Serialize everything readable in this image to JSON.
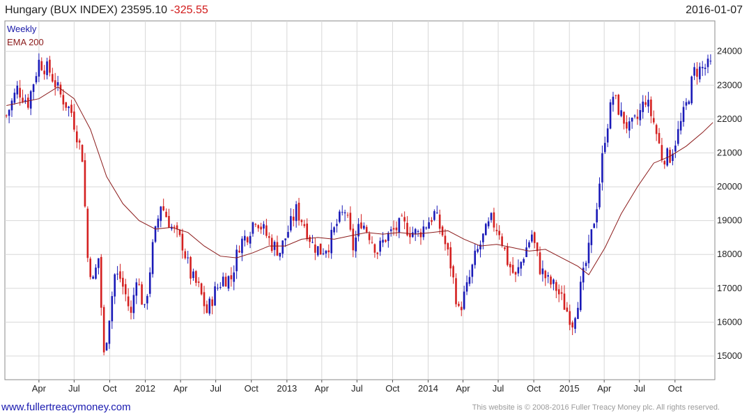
{
  "header": {
    "name": "Hungary (BUX INDEX)",
    "last": "23595.10",
    "change": "-325.55",
    "date": "2016-01-07"
  },
  "legend": {
    "series1": "Weekly",
    "series2": "EMA 200"
  },
  "footer": {
    "link": "www.fullertreacymoney.com",
    "copyright": "This website is © 2008-2016 Fuller Treacy Money plc. All rights reserved."
  },
  "colors": {
    "up": "#1a1ab8",
    "down": "#d42020",
    "ema": "#8b1a1a",
    "grid": "#d8d8d8",
    "change": "#d11a1a"
  },
  "chart_data": {
    "type": "line",
    "title": "Hungary (BUX INDEX) 23595.10 -325.55",
    "ylim": [
      14300,
      24900
    ],
    "yticks": [
      15000,
      16000,
      17000,
      18000,
      19000,
      20000,
      21000,
      22000,
      23000,
      24000
    ],
    "ytick_labels": [
      "15000",
      "16000",
      "17000",
      "18000",
      "19000",
      "20000",
      "21000",
      "22000",
      "23000",
      "24000"
    ],
    "xticks": [
      {
        "date": "2011-04-01",
        "label": "Apr"
      },
      {
        "date": "2011-07-01",
        "label": "Jul"
      },
      {
        "date": "2011-10-01",
        "label": "Oct"
      },
      {
        "date": "2012-01-01",
        "label": "2012"
      },
      {
        "date": "2012-04-01",
        "label": "Apr"
      },
      {
        "date": "2012-07-01",
        "label": "Jul"
      },
      {
        "date": "2012-10-01",
        "label": "Oct"
      },
      {
        "date": "2013-01-01",
        "label": "2013"
      },
      {
        "date": "2013-04-01",
        "label": "Apr"
      },
      {
        "date": "2013-07-01",
        "label": "Jul"
      },
      {
        "date": "2013-10-01",
        "label": "Oct"
      },
      {
        "date": "2014-01-01",
        "label": "2014"
      },
      {
        "date": "2014-04-01",
        "label": "Apr"
      },
      {
        "date": "2014-07-01",
        "label": "Jul"
      },
      {
        "date": "2014-10-01",
        "label": "Oct"
      },
      {
        "date": "2015-01-01",
        "label": "2015"
      },
      {
        "date": "2015-04-01",
        "label": "Apr"
      },
      {
        "date": "2015-07-01",
        "label": "Jul"
      },
      {
        "date": "2015-10-01",
        "label": "Oct"
      }
    ],
    "series": [
      {
        "name": "Weekly",
        "kind": "close",
        "points": [
          [
            "2011-01-07",
            22100
          ],
          [
            "2011-02-04",
            22900
          ],
          [
            "2011-03-04",
            22500
          ],
          [
            "2011-04-01",
            23700
          ],
          [
            "2011-04-29",
            23400
          ],
          [
            "2011-05-27",
            22700
          ],
          [
            "2011-06-24",
            22200
          ],
          [
            "2011-07-22",
            20900
          ],
          [
            "2011-08-05",
            17900
          ],
          [
            "2011-08-19",
            17200
          ],
          [
            "2011-09-02",
            17900
          ],
          [
            "2011-09-16",
            15000
          ],
          [
            "2011-09-30",
            16200
          ],
          [
            "2011-10-14",
            17400
          ],
          [
            "2011-10-28",
            17300
          ],
          [
            "2011-11-11",
            16800
          ],
          [
            "2011-11-25",
            16200
          ],
          [
            "2011-12-09",
            17400
          ],
          [
            "2011-12-30",
            16300
          ],
          [
            "2012-01-20",
            18200
          ],
          [
            "2012-02-10",
            19500
          ],
          [
            "2012-03-09",
            18800
          ],
          [
            "2012-04-06",
            18300
          ],
          [
            "2012-04-27",
            17400
          ],
          [
            "2012-05-18",
            17000
          ],
          [
            "2012-06-08",
            16300
          ],
          [
            "2012-06-29",
            16900
          ],
          [
            "2012-07-20",
            17300
          ],
          [
            "2012-08-10",
            17300
          ],
          [
            "2012-08-31",
            18300
          ],
          [
            "2012-09-21",
            18600
          ],
          [
            "2012-10-12",
            19100
          ],
          [
            "2012-11-02",
            18700
          ],
          [
            "2012-11-23",
            18300
          ],
          [
            "2012-12-14",
            18100
          ],
          [
            "2013-01-04",
            18700
          ],
          [
            "2013-01-25",
            19300
          ],
          [
            "2013-02-15",
            18900
          ],
          [
            "2013-03-08",
            18300
          ],
          [
            "2013-03-29",
            18100
          ],
          [
            "2013-04-19",
            18300
          ],
          [
            "2013-05-10",
            18900
          ],
          [
            "2013-05-31",
            19300
          ],
          [
            "2013-06-21",
            18200
          ],
          [
            "2013-07-12",
            19000
          ],
          [
            "2013-08-02",
            18600
          ],
          [
            "2013-08-23",
            18100
          ],
          [
            "2013-09-13",
            18500
          ],
          [
            "2013-10-04",
            18700
          ],
          [
            "2013-10-25",
            18900
          ],
          [
            "2013-11-15",
            18700
          ],
          [
            "2013-12-06",
            18600
          ],
          [
            "2013-12-27",
            18900
          ],
          [
            "2014-01-17",
            19200
          ],
          [
            "2014-02-07",
            18600
          ],
          [
            "2014-02-28",
            17700
          ],
          [
            "2014-03-21",
            16300
          ],
          [
            "2014-04-11",
            17000
          ],
          [
            "2014-05-02",
            17900
          ],
          [
            "2014-05-23",
            18500
          ],
          [
            "2014-06-13",
            19000
          ],
          [
            "2014-07-04",
            18700
          ],
          [
            "2014-07-25",
            17800
          ],
          [
            "2014-08-15",
            17300
          ],
          [
            "2014-09-05",
            18000
          ],
          [
            "2014-09-26",
            18600
          ],
          [
            "2014-10-17",
            17600
          ],
          [
            "2014-11-07",
            17200
          ],
          [
            "2014-11-28",
            17000
          ],
          [
            "2014-12-19",
            16500
          ],
          [
            "2015-01-09",
            16000
          ],
          [
            "2015-01-30",
            17000
          ],
          [
            "2015-02-20",
            18100
          ],
          [
            "2015-03-13",
            19500
          ],
          [
            "2015-04-03",
            21500
          ],
          [
            "2015-04-24",
            22700
          ],
          [
            "2015-05-15",
            22100
          ],
          [
            "2015-06-05",
            21700
          ],
          [
            "2015-06-26",
            22000
          ],
          [
            "2015-07-17",
            22600
          ],
          [
            "2015-08-07",
            21900
          ],
          [
            "2015-08-28",
            20900
          ],
          [
            "2015-09-18",
            20900
          ],
          [
            "2015-10-09",
            21600
          ],
          [
            "2015-10-30",
            22400
          ],
          [
            "2015-11-20",
            23400
          ],
          [
            "2015-12-11",
            23500
          ],
          [
            "2016-01-07",
            23595
          ]
        ]
      },
      {
        "name": "EMA 200",
        "kind": "line",
        "points": [
          [
            "2011-01-07",
            22400
          ],
          [
            "2011-04-01",
            22600
          ],
          [
            "2011-05-20",
            22950
          ],
          [
            "2011-07-01",
            22600
          ],
          [
            "2011-08-12",
            21700
          ],
          [
            "2011-09-23",
            20300
          ],
          [
            "2011-11-04",
            19500
          ],
          [
            "2011-12-16",
            19000
          ],
          [
            "2012-01-27",
            18750
          ],
          [
            "2012-03-09",
            18800
          ],
          [
            "2012-04-20",
            18650
          ],
          [
            "2012-06-01",
            18250
          ],
          [
            "2012-07-13",
            17950
          ],
          [
            "2012-08-24",
            17900
          ],
          [
            "2012-10-05",
            18050
          ],
          [
            "2012-11-16",
            18250
          ],
          [
            "2012-12-28",
            18250
          ],
          [
            "2013-02-08",
            18450
          ],
          [
            "2013-03-22",
            18500
          ],
          [
            "2013-05-03",
            18450
          ],
          [
            "2013-06-14",
            18550
          ],
          [
            "2013-07-26",
            18650
          ],
          [
            "2013-09-06",
            18600
          ],
          [
            "2013-10-18",
            18650
          ],
          [
            "2013-11-29",
            18600
          ],
          [
            "2014-01-10",
            18650
          ],
          [
            "2014-02-21",
            18700
          ],
          [
            "2014-04-04",
            18450
          ],
          [
            "2014-05-16",
            18250
          ],
          [
            "2014-06-27",
            18300
          ],
          [
            "2014-08-08",
            18200
          ],
          [
            "2014-09-19",
            18100
          ],
          [
            "2014-10-31",
            18150
          ],
          [
            "2014-12-12",
            17900
          ],
          [
            "2015-01-23",
            17650
          ],
          [
            "2015-02-20",
            17400
          ],
          [
            "2015-04-03",
            18200
          ],
          [
            "2015-05-15",
            19200
          ],
          [
            "2015-06-26",
            20000
          ],
          [
            "2015-08-07",
            20700
          ],
          [
            "2015-09-18",
            20900
          ],
          [
            "2015-10-30",
            21200
          ],
          [
            "2015-12-11",
            21600
          ],
          [
            "2016-01-07",
            21900
          ]
        ]
      }
    ],
    "grid": true,
    "legend_position": "top-left"
  }
}
